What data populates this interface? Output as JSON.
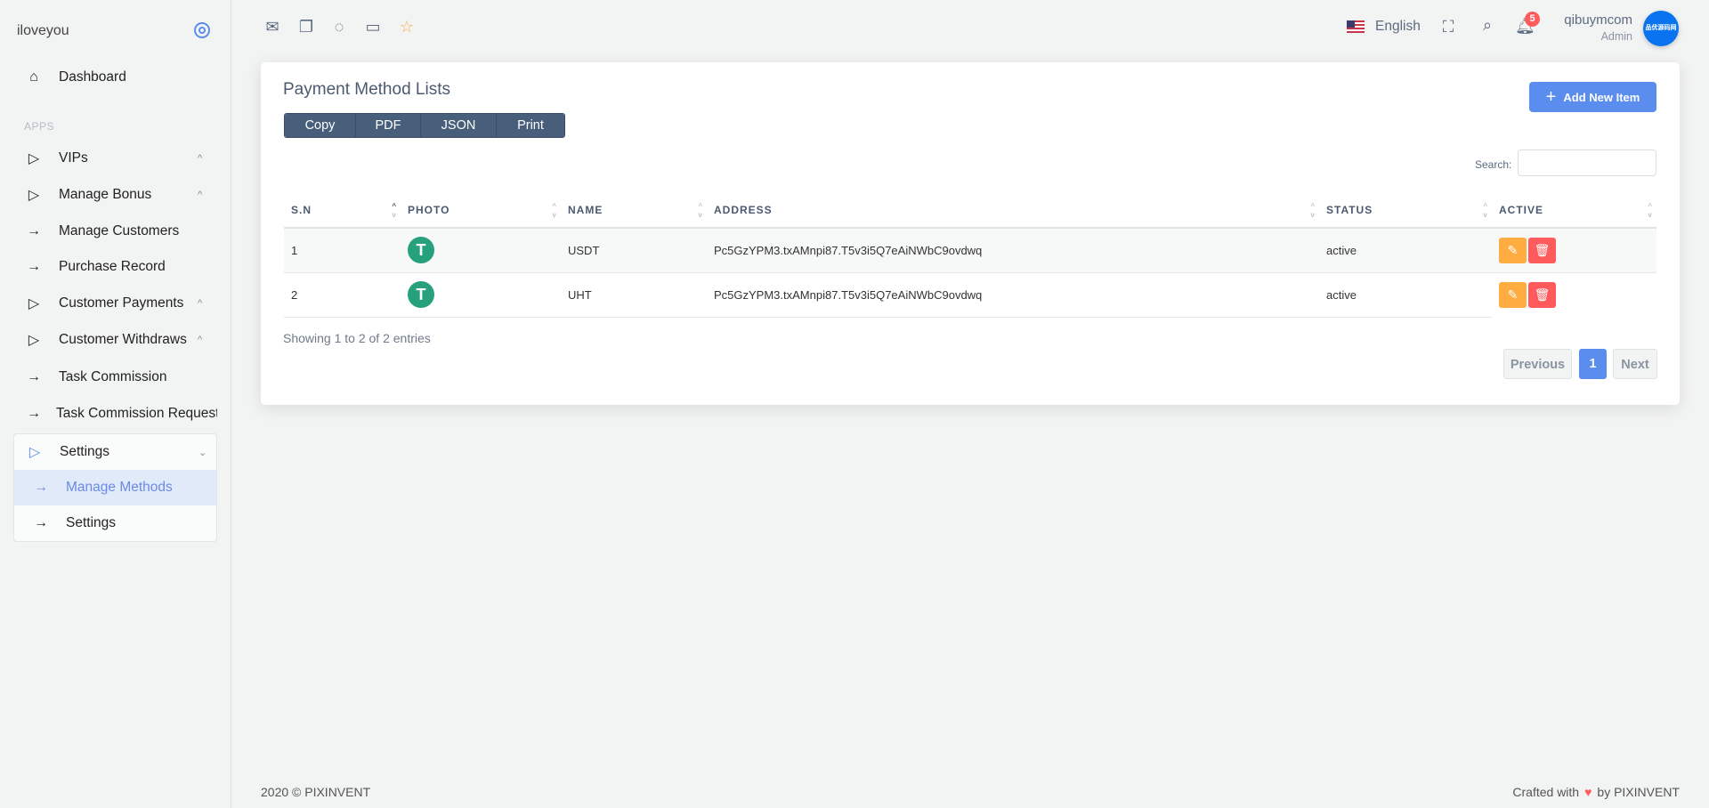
{
  "sidebar": {
    "brand": "iloveyou",
    "dashboard": "Dashboard",
    "section": "APPS",
    "items": [
      {
        "label": "VIPs"
      },
      {
        "label": "Manage Bonus"
      },
      {
        "label": "Manage Customers"
      },
      {
        "label": "Purchase Record"
      },
      {
        "label": "Customer Payments"
      },
      {
        "label": "Customer Withdraws"
      },
      {
        "label": "Task Commission"
      },
      {
        "label": "Task Commission Request"
      }
    ],
    "settings": {
      "label": "Settings",
      "children": [
        {
          "label": "Manage Methods"
        },
        {
          "label": "Settings"
        }
      ]
    }
  },
  "header": {
    "language": "English",
    "notifications": "5",
    "user_name": "qibuymcom",
    "user_role": "Admin",
    "avatar_text": "品优源码网"
  },
  "card": {
    "title": "Payment Method Lists",
    "export_buttons": [
      "Copy",
      "PDF",
      "JSON",
      "Print"
    ],
    "add_button": "Add New Item",
    "search_label": "Search:",
    "search_value": "",
    "columns": [
      "S.N",
      "PHOTO",
      "NAME",
      "ADDRESS",
      "STATUS",
      "ACTIVE"
    ],
    "rows": [
      {
        "sn": "1",
        "photo": "T",
        "name": "USDT",
        "address": "Pc5GzYPM3.txAMnpi87.T5v3i5Q7eAiNWbC9ovdwq",
        "status": "active"
      },
      {
        "sn": "2",
        "photo": "T",
        "name": "UHT",
        "address": "Pc5GzYPM3.txAMnpi87.T5v3i5Q7eAiNWbC9ovdwq",
        "status": "active"
      }
    ],
    "showing": "Showing 1 to 2 of 2 entries",
    "pagination": {
      "previous": "Previous",
      "current": "1",
      "next": "Next"
    }
  },
  "footer": {
    "left": "2020 © PIXINVENT",
    "right_pre": "Crafted with",
    "right_post": "by PIXINVENT"
  },
  "colors": {
    "primary": "#5b8def",
    "edit": "#ffac40",
    "delete": "#ff5b5c",
    "tether": "#26a17b"
  }
}
